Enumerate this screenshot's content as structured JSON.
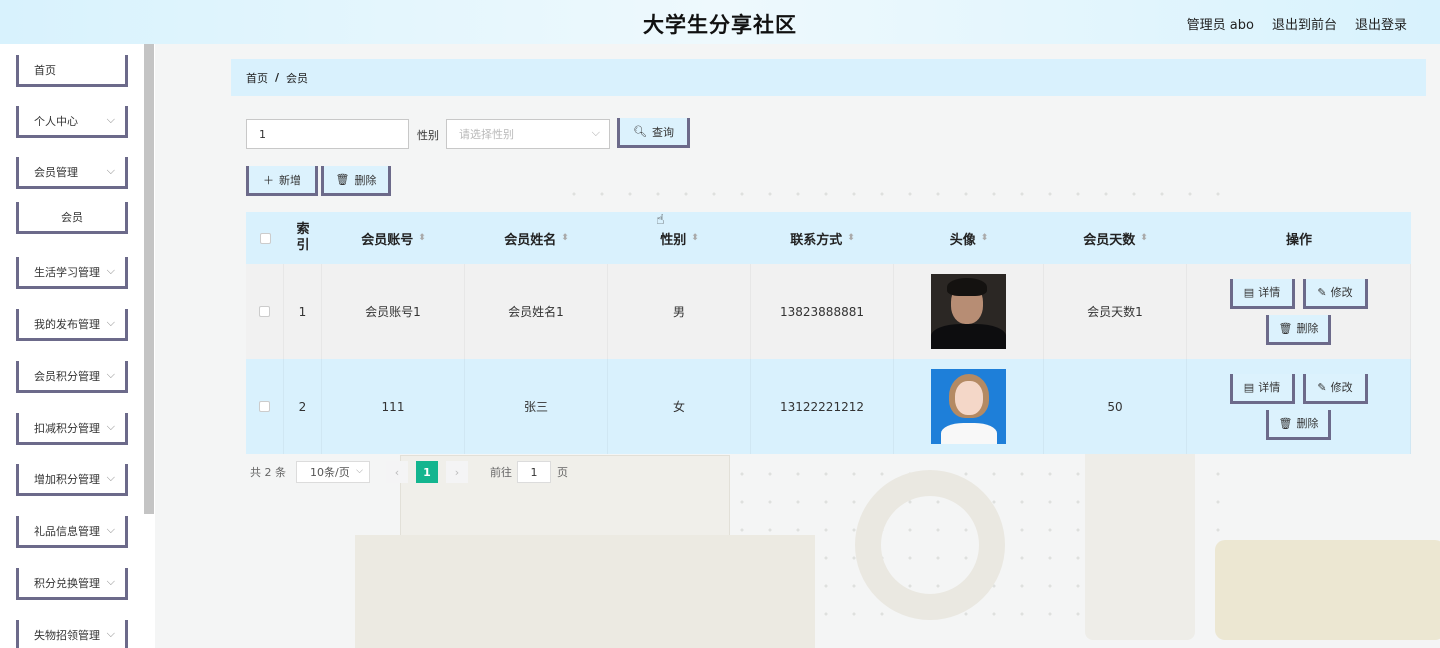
{
  "header": {
    "title": "大学生分享社区",
    "user": "管理员 abo",
    "front_link": "退出到前台",
    "logout": "退出登录"
  },
  "sidebar": {
    "items": [
      {
        "label": "首页",
        "expandable": false
      },
      {
        "label": "个人中心",
        "expandable": true
      },
      {
        "label": "会员管理",
        "expandable": true
      },
      {
        "label": "会员",
        "expandable": false,
        "sub": true
      },
      {
        "label": "生活学习管理",
        "expandable": true
      },
      {
        "label": "我的发布管理",
        "expandable": true
      },
      {
        "label": "会员积分管理",
        "expandable": true
      },
      {
        "label": "扣减积分管理",
        "expandable": true
      },
      {
        "label": "增加积分管理",
        "expandable": true
      },
      {
        "label": "礼品信息管理",
        "expandable": true
      },
      {
        "label": "积分兑换管理",
        "expandable": true
      },
      {
        "label": "失物招领管理",
        "expandable": true
      }
    ]
  },
  "breadcrumb": {
    "home": "首页",
    "sep": "/",
    "current": "会员"
  },
  "search": {
    "keyword_value": "1",
    "gender_label": "性别",
    "gender_placeholder": "请选择性别",
    "query_label": "查询"
  },
  "actions": {
    "add_label": "新增",
    "delete_label": "删除"
  },
  "table": {
    "headers": {
      "index": "索引",
      "account": "会员账号",
      "name": "会员姓名",
      "gender": "性别",
      "phone": "联系方式",
      "avatar": "头像",
      "days": "会员天数",
      "ops": "操作"
    },
    "rows": [
      {
        "index": "1",
        "account": "会员账号1",
        "name": "会员姓名1",
        "gender": "男",
        "phone": "13823888881",
        "days": "会员天数1"
      },
      {
        "index": "2",
        "account": "111",
        "name": "张三",
        "gender": "女",
        "phone": "13122221212",
        "days": "50"
      }
    ],
    "row_ops": {
      "detail": "详情",
      "edit": "修改",
      "delete": "删除"
    }
  },
  "pagination": {
    "total": "共 2 条",
    "page_size": "10条/页",
    "current_page": "1",
    "goto_label": "前往",
    "goto_value": "1",
    "page_suffix": "页"
  },
  "colors": {
    "header_bg": "#d8f2fd",
    "button_bg": "#dcf2fd",
    "button_border": "#6c6a8a",
    "active_page": "#13b58f"
  }
}
